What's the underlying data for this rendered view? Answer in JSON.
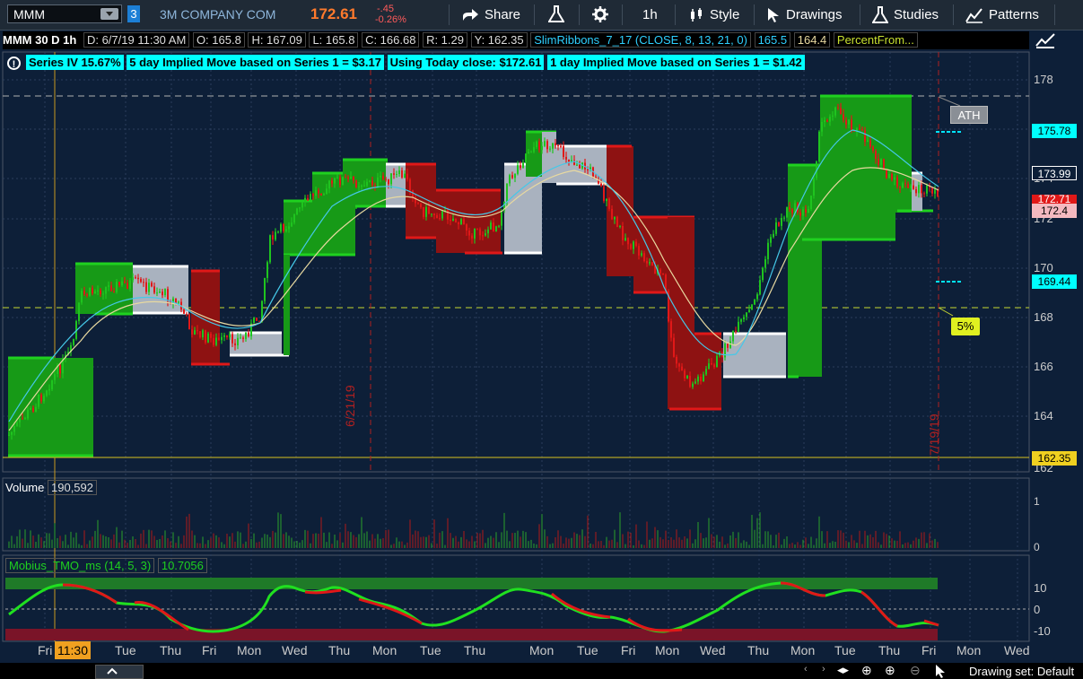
{
  "toolbar": {
    "symbol": "MMM",
    "link_group": "3",
    "company": "3M COMPANY COM",
    "price": "172.61",
    "change": "-.45",
    "change_pct": "-0.26%",
    "share": "Share",
    "timeframe": "1h",
    "style": "Style",
    "drawings": "Drawings",
    "studies": "Studies",
    "patterns": "Patterns"
  },
  "header": {
    "title": "MMM 30 D 1h",
    "date": "D: 6/7/19 11:30 AM",
    "open": "O: 165.8",
    "high": "H: 167.09",
    "low": "L: 165.8",
    "close": "C: 166.68",
    "range": "R: 1.29",
    "y": "Y: 162.35",
    "study": "SlimRibbons_7_17 (CLOSE, 8, 13, 21, 0)",
    "study_v1": "165.5",
    "study_v2": "164.4",
    "study2": "PercentFrom..."
  },
  "info": {
    "iv": "Series IV 15.67%",
    "move5": "5 day Implied Move based on Series 1 = $3.17",
    "close": "Using Today close: $172.61",
    "move1": "1 day Implied Move based on Series 1 = $1.42"
  },
  "price_axis": {
    "ticks": [
      "178",
      "176",
      "174",
      "172",
      "170",
      "168",
      "166",
      "164",
      "162"
    ],
    "box_1": "175.78",
    "box_2": "173.99",
    "box_3": "172.71",
    "box_4": "172.4",
    "box_5": "169.44",
    "box_6": "162.35",
    "ath": "ATH",
    "pct": "5%"
  },
  "date_markers": [
    "6/21/19",
    "7/19/19"
  ],
  "volume": {
    "label": "Volume",
    "value": "190,592",
    "axis_top": "1",
    "axis_bottom": "0"
  },
  "tmo": {
    "label": "Mobius_TMO_ms (14, 5, 3)",
    "value": "10.7056",
    "axis": [
      "10",
      "0",
      "-10"
    ]
  },
  "x_axis": {
    "labels": [
      "Fri",
      "Tue",
      "Thu",
      "Fri",
      "Mon",
      "Wed",
      "Thu",
      "Mon",
      "Tue",
      "Thu",
      "Mon",
      "Tue",
      "Fri",
      "Mon",
      "Wed",
      "Thu",
      "Mon",
      "Tue",
      "Thu",
      "Fri",
      "Mon",
      "Wed"
    ],
    "cursor": "11:30"
  },
  "status": {
    "drawing_set": "Drawing set: Default"
  },
  "colors": {
    "bull": "#1fc41f",
    "bear": "#e01818",
    "neutral": "#c8ccd2",
    "bg": "#0d1f38"
  }
}
